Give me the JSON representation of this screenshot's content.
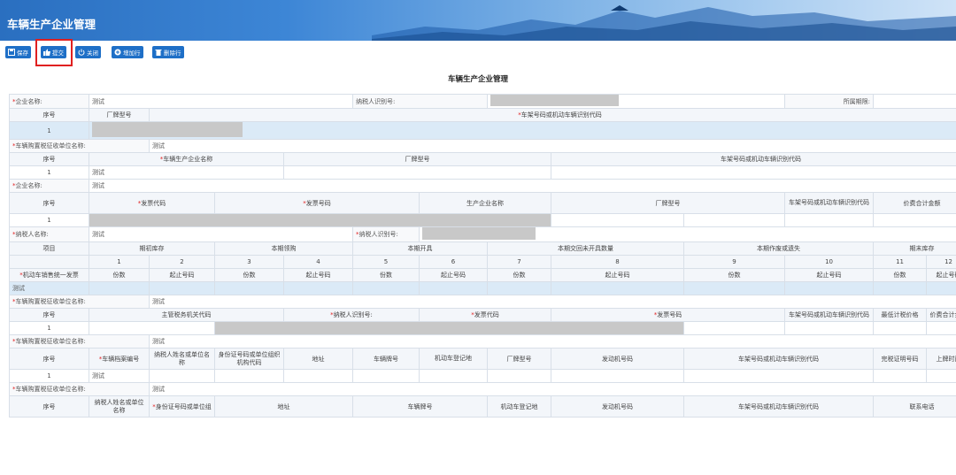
{
  "header": {
    "title": "车辆生产企业管理"
  },
  "toolbar": {
    "save": "保存",
    "submit": "提交",
    "close": "关闭",
    "add_row": "增加行",
    "delete_row": "删除行"
  },
  "form_title": "车辆生产企业管理",
  "labels": {
    "req_mark": "*",
    "company_name": "企业名称:",
    "taxpayer_id": "纳税人识别号:",
    "period": "所属期限:",
    "seq": "序号",
    "brand_model": "厂牌型号",
    "vin": "车架号码或机动车辆识别代码",
    "tax_office": "车辆购置税征收单位名称:",
    "vehicle_maker": "车辆生产企业名称",
    "invoice_code": "发票代码",
    "invoice_no": "发票号码",
    "maker_name": "生产企业名称",
    "vin_short": "车架号码或机动车辆识别代码",
    "total_amount": "价费合计金额",
    "taxpayer_name": "纳税人名称:",
    "item": "项目",
    "opening": "期初库存",
    "purchased": "本期领购",
    "issued": "本期开具",
    "returned": "本期交回未开具数量",
    "voided": "本期作废或遗失",
    "closing": "期末库存",
    "unified_invoice": "机动车销售统一发票",
    "copies": "份数",
    "range": "起止号码",
    "competent_office": "主管税务机关代码",
    "min_price": "最低计税价格",
    "archive_no": "车辆档案编号",
    "owner_name": "纳税人姓名或单位名称",
    "id_code": "身份证号码或单位组织机构代码",
    "address": "地址",
    "plate": "车辆牌号",
    "reg_place": "机动车登记地",
    "engine_no": "发动机号码",
    "cert_no": "完税证明号码",
    "report_time": "上牌时间",
    "owner_name2": "纳税人姓名或单位名称",
    "id_code2": "身份证号码或单位组",
    "phone": "联系电话"
  },
  "values": {
    "test": "测试",
    "row1": "1"
  },
  "column_numbers": [
    "1",
    "2",
    "3",
    "4",
    "5",
    "6",
    "7",
    "8",
    "9",
    "10",
    "11",
    "12"
  ],
  "colors": {
    "toolbar_button": "#1e6fc7",
    "highlight": "#e02020",
    "selected_row": "#dbeaf7"
  }
}
